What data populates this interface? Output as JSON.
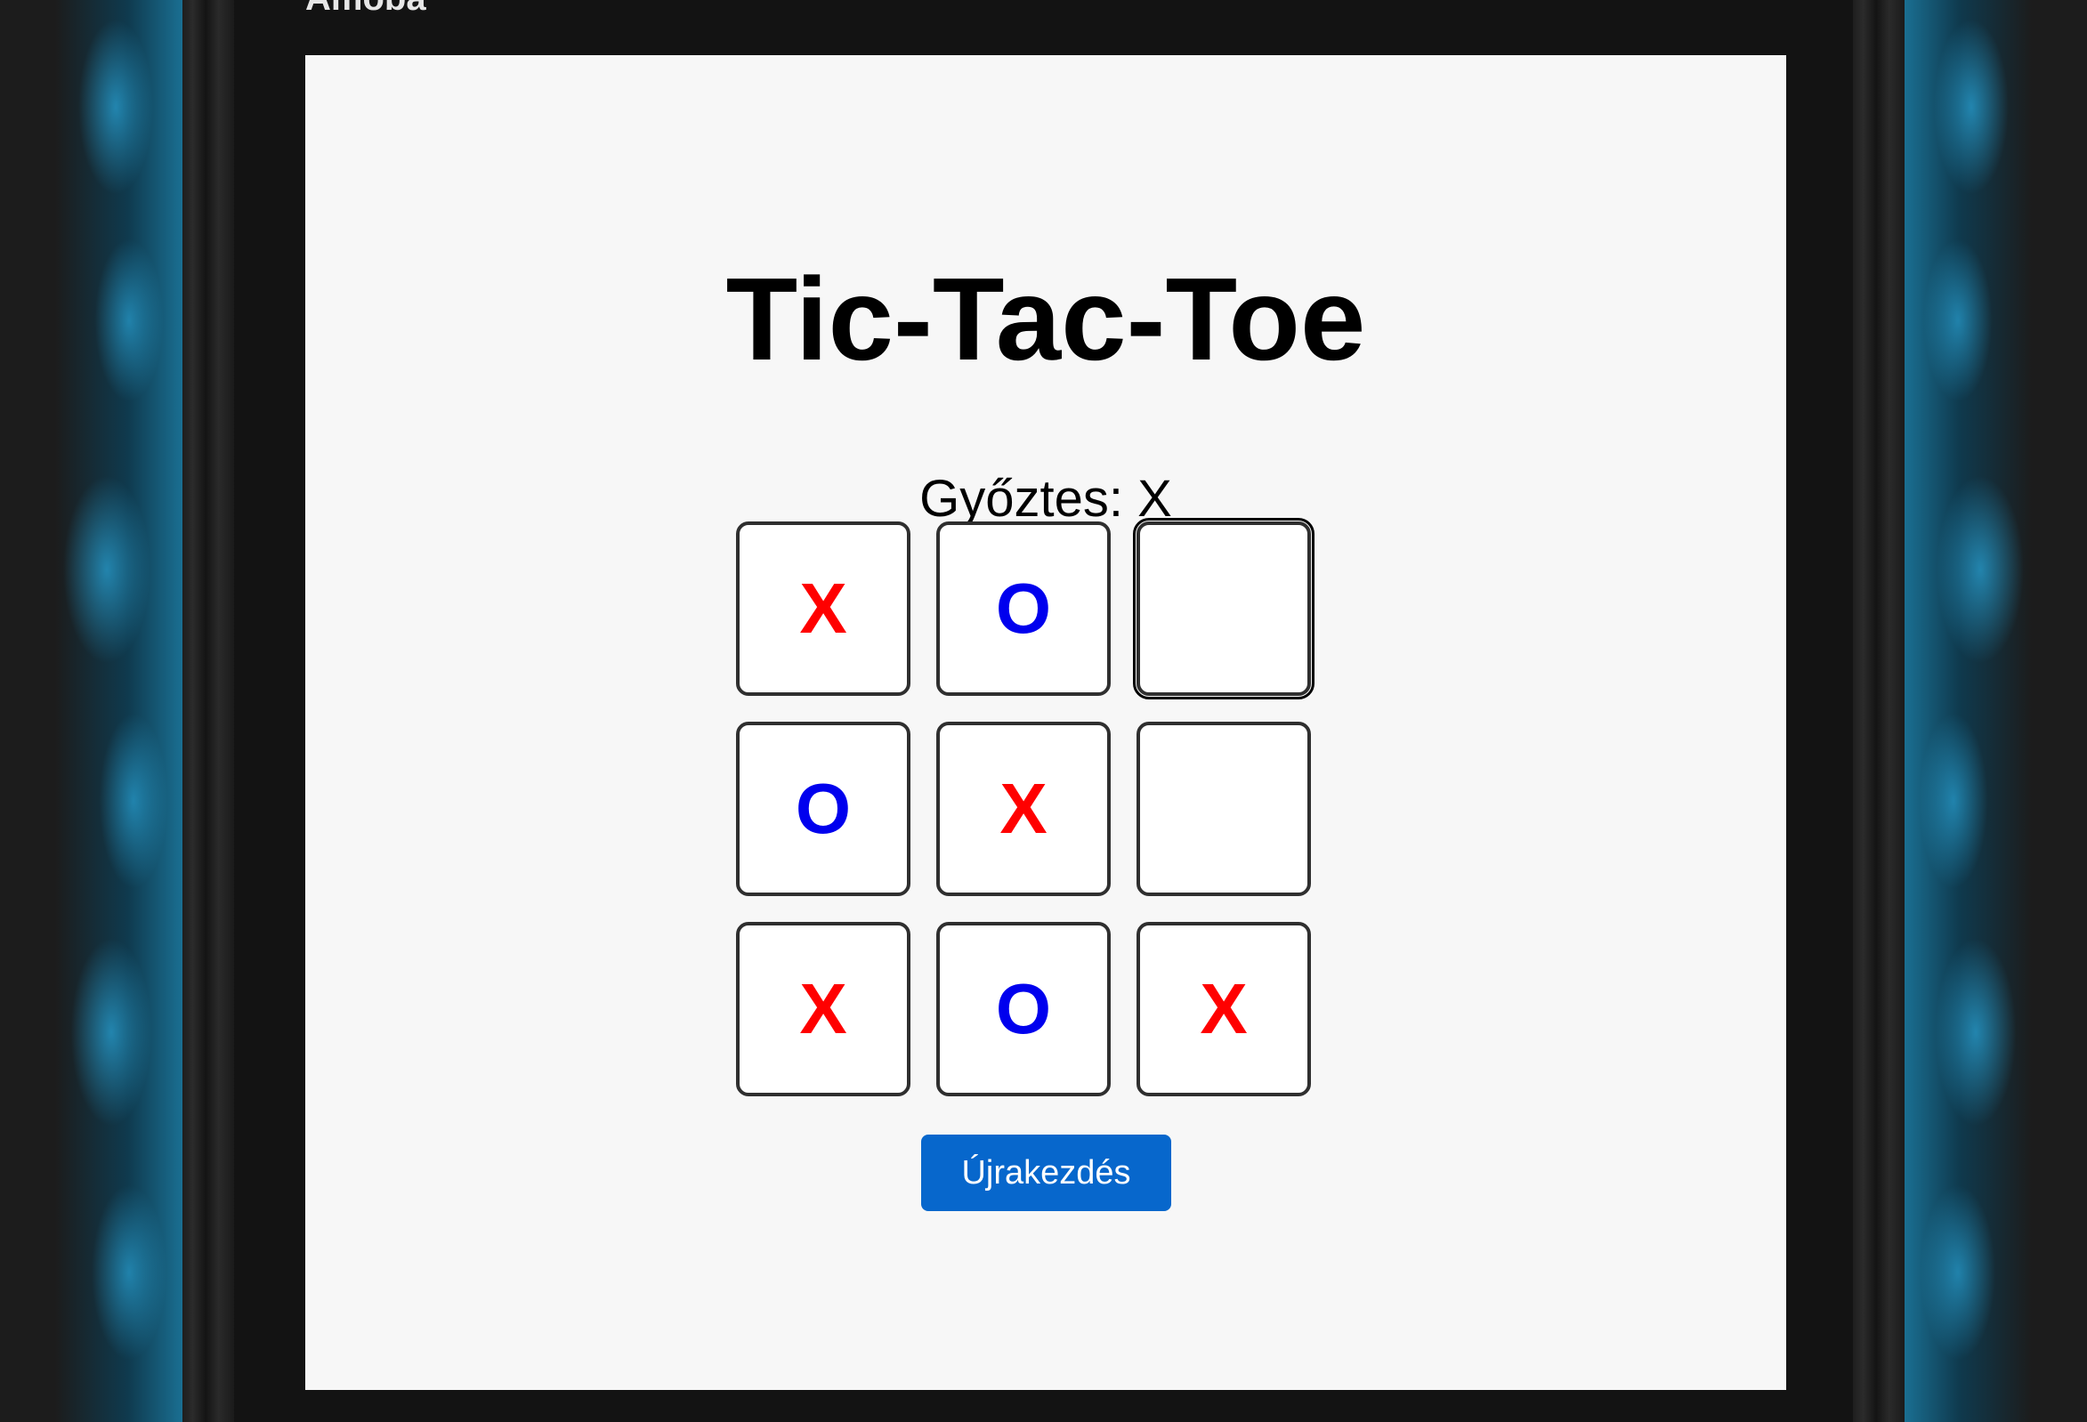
{
  "app": {
    "title": "Amoba"
  },
  "game": {
    "heading": "Tic-Tac-Toe",
    "status": "Győztes: X",
    "board": [
      "X",
      "O",
      "",
      "O",
      "X",
      "",
      "X",
      "O",
      "X"
    ],
    "restart_label": "Újrakezdés"
  },
  "colors": {
    "x_mark": "#ff0000",
    "o_mark": "#0000ee",
    "button": "#0767cc"
  }
}
